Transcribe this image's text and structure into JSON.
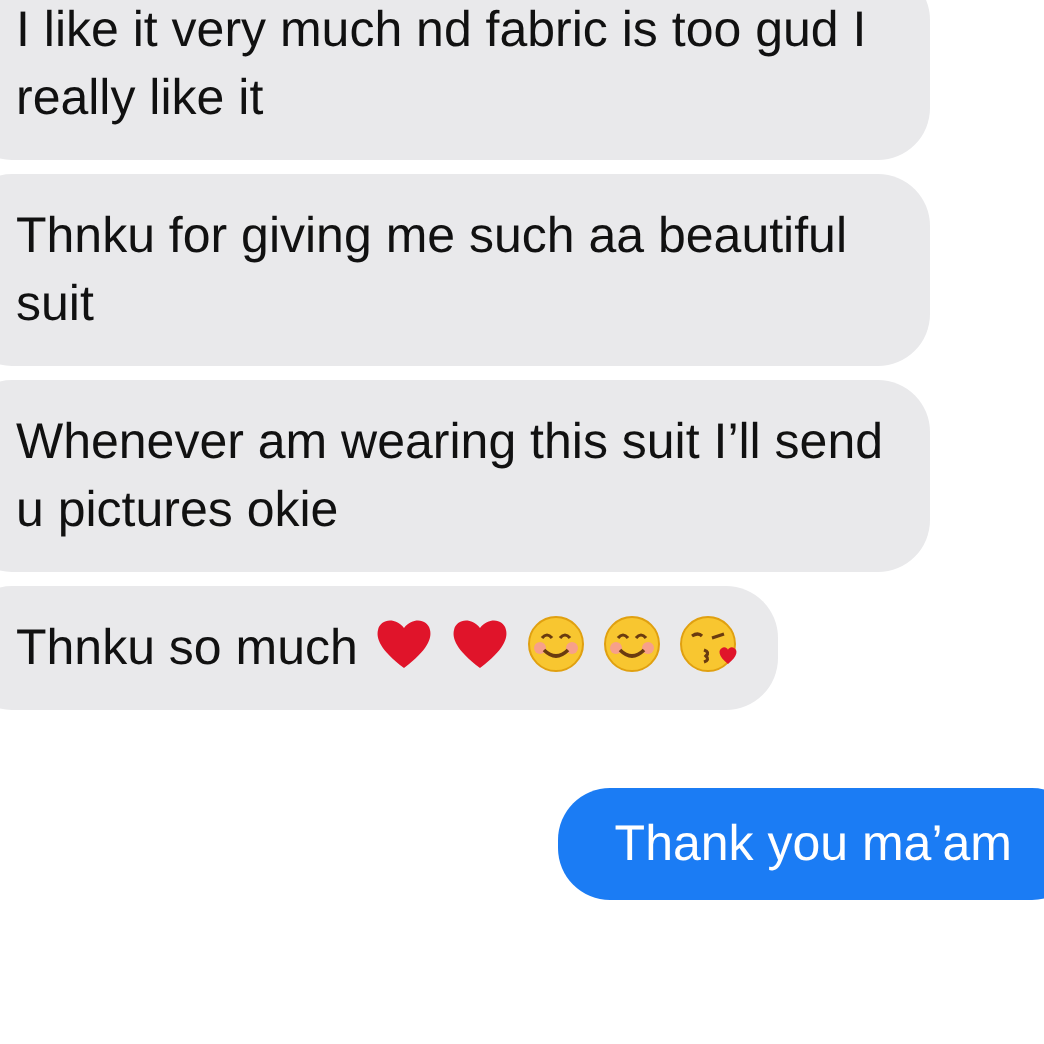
{
  "messages": [
    {
      "kind": "received",
      "text": "I like it very much nd fabric is too gud I really like it"
    },
    {
      "kind": "received",
      "text": "Thnku for giving me such aa beautiful suit"
    },
    {
      "kind": "received",
      "text": "Whenever am wearing this suit I’ll send u pictures okie"
    },
    {
      "kind": "received",
      "text": "Thnku so much",
      "emojis": [
        {
          "kind": "heart"
        },
        {
          "kind": "heart"
        },
        {
          "kind": "smile"
        },
        {
          "kind": "smile"
        },
        {
          "kind": "kiss"
        }
      ]
    },
    {
      "kind": "sent",
      "text": "Thank you ma’am"
    }
  ]
}
